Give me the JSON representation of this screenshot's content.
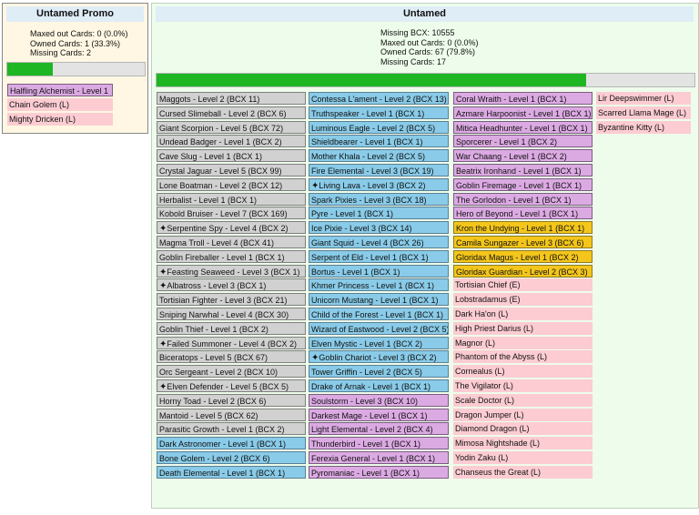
{
  "colors": {
    "common": "#d1d1d1",
    "rare": "#89cbe8",
    "epic": "#dcaae3",
    "legendary": "#f4c61b",
    "missing": "#fcccd2",
    "progress": "#1fb623"
  },
  "promo": {
    "title": "Untamed Promo",
    "stats": [
      "Maxed out Cards: 0 (0.0%)",
      "Owned Cards: 1 (33.3%)",
      "Missing Cards: 2"
    ],
    "progress": 0.333,
    "cards": [
      {
        "label": "Halfling Alchemist - Level 1",
        "color": "purple"
      },
      {
        "label": "Chain Golem (L)",
        "color": "pink"
      },
      {
        "label": "Mighty Dricken (L)",
        "color": "pink"
      }
    ]
  },
  "untamed": {
    "title": "Untamed",
    "stats": [
      "Missing BCX: 10555",
      "Maxed out Cards: 0 (0.0%)",
      "Owned Cards: 67 (79.8%)",
      "Missing Cards: 17"
    ],
    "progress": 0.798,
    "columns": [
      [
        {
          "label": "Maggots - Level 2 (BCX 11)",
          "color": "gray"
        },
        {
          "label": "Cursed Slimeball - Level 2 (BCX 6)",
          "color": "gray"
        },
        {
          "label": "Giant Scorpion - Level 5 (BCX 72)",
          "color": "gray"
        },
        {
          "label": "Undead Badger - Level 1 (BCX 2)",
          "color": "gray"
        },
        {
          "label": "Cave Slug - Level 1 (BCX 1)",
          "color": "gray"
        },
        {
          "label": "Crystal Jaguar - Level 5 (BCX 99)",
          "color": "gray"
        },
        {
          "label": "Lone Boatman - Level 2 (BCX 12)",
          "color": "gray"
        },
        {
          "label": "Herbalist - Level 1 (BCX 1)",
          "color": "gray"
        },
        {
          "label": "Kobold Bruiser - Level 7 (BCX 169)",
          "color": "gray"
        },
        {
          "label": "Serpentine Spy - Level 4 (BCX 2)",
          "color": "gray",
          "star": true
        },
        {
          "label": "Magma Troll - Level 4 (BCX 41)",
          "color": "gray"
        },
        {
          "label": "Goblin Fireballer - Level 1 (BCX 1)",
          "color": "gray"
        },
        {
          "label": "Feasting Seaweed - Level 3 (BCX 1)",
          "color": "gray",
          "star": true
        },
        {
          "label": "Albatross - Level 3 (BCX 1)",
          "color": "gray",
          "star": true
        },
        {
          "label": "Tortisian Fighter - Level 3 (BCX 21)",
          "color": "gray"
        },
        {
          "label": "Sniping Narwhal - Level 4 (BCX 30)",
          "color": "gray"
        },
        {
          "label": "Goblin Thief - Level 1 (BCX 2)",
          "color": "gray"
        },
        {
          "label": "Failed Summoner - Level 4 (BCX 2)",
          "color": "gray",
          "star": true
        },
        {
          "label": "Biceratops - Level 5 (BCX 67)",
          "color": "gray"
        },
        {
          "label": "Orc Sergeant - Level 2 (BCX 10)",
          "color": "gray"
        },
        {
          "label": "Elven Defender - Level 5 (BCX 5)",
          "color": "gray",
          "star": true
        },
        {
          "label": "Horny Toad - Level 2 (BCX 6)",
          "color": "gray"
        },
        {
          "label": "Mantoid - Level 5 (BCX 62)",
          "color": "gray"
        },
        {
          "label": "Parasitic Growth - Level 1 (BCX 2)",
          "color": "gray"
        },
        {
          "label": "Dark Astronomer - Level 1 (BCX 1)",
          "color": "blue"
        },
        {
          "label": "Bone Golem - Level 2 (BCX 6)",
          "color": "blue"
        },
        {
          "label": "Death Elemental - Level 1 (BCX 1)",
          "color": "blue"
        }
      ],
      [
        {
          "label": "Contessa L'ament - Level 2 (BCX 13)",
          "color": "blue"
        },
        {
          "label": "Truthspeaker - Level 1 (BCX 1)",
          "color": "blue"
        },
        {
          "label": "Luminous Eagle - Level 2 (BCX 5)",
          "color": "blue"
        },
        {
          "label": "Shieldbearer - Level 1 (BCX 1)",
          "color": "blue"
        },
        {
          "label": "Mother Khala - Level 2 (BCX 5)",
          "color": "blue"
        },
        {
          "label": "Fire Elemental - Level 3 (BCX 19)",
          "color": "blue"
        },
        {
          "label": "Living Lava - Level 3 (BCX 2)",
          "color": "blue",
          "star": true
        },
        {
          "label": "Spark Pixies - Level 3 (BCX 18)",
          "color": "blue"
        },
        {
          "label": "Pyre - Level 1 (BCX 1)",
          "color": "blue"
        },
        {
          "label": "Ice Pixie - Level 3 (BCX 14)",
          "color": "blue"
        },
        {
          "label": "Giant Squid - Level 4 (BCX 26)",
          "color": "blue"
        },
        {
          "label": "Serpent of Eld - Level 1 (BCX 1)",
          "color": "blue"
        },
        {
          "label": "Bortus - Level 1 (BCX 1)",
          "color": "blue"
        },
        {
          "label": "Khmer Princess - Level 1 (BCX 1)",
          "color": "blue"
        },
        {
          "label": "Unicorn Mustang - Level 1 (BCX 1)",
          "color": "blue"
        },
        {
          "label": "Child of the Forest - Level 1 (BCX 1)",
          "color": "blue"
        },
        {
          "label": "Wizard of Eastwood - Level 2 (BCX 5)",
          "color": "blue"
        },
        {
          "label": "Elven Mystic - Level 1 (BCX 2)",
          "color": "blue"
        },
        {
          "label": "Goblin Chariot - Level 3 (BCX 2)",
          "color": "blue",
          "star": true
        },
        {
          "label": "Tower Griffin - Level 2 (BCX 5)",
          "color": "blue"
        },
        {
          "label": "Drake of Arnak - Level 1 (BCX 1)",
          "color": "blue"
        },
        {
          "label": "Soulstorm - Level 3 (BCX 10)",
          "color": "purple"
        },
        {
          "label": "Darkest Mage - Level 1 (BCX 1)",
          "color": "purple"
        },
        {
          "label": "Light Elemental - Level 2 (BCX 4)",
          "color": "purple"
        },
        {
          "label": "Thunderbird - Level 1 (BCX 1)",
          "color": "purple"
        },
        {
          "label": "Ferexia General - Level 1 (BCX 1)",
          "color": "purple"
        },
        {
          "label": "Pyromaniac - Level 1 (BCX 1)",
          "color": "purple"
        }
      ],
      [
        {
          "label": "Coral Wraith - Level 1 (BCX 1)",
          "color": "purple"
        },
        {
          "label": "Azmare Harpoonist - Level 1 (BCX 1)",
          "color": "purple"
        },
        {
          "label": "Mitica Headhunter - Level 1 (BCX 1)",
          "color": "purple"
        },
        {
          "label": "Sporcerer - Level 1 (BCX 2)",
          "color": "purple"
        },
        {
          "label": "War Chaang - Level 1 (BCX 2)",
          "color": "purple"
        },
        {
          "label": "Beatrix Ironhand - Level 1 (BCX 1)",
          "color": "purple"
        },
        {
          "label": "Goblin Firemage - Level 1 (BCX 1)",
          "color": "purple"
        },
        {
          "label": "The Gorlodon - Level 1 (BCX 1)",
          "color": "purple"
        },
        {
          "label": "Hero of Beyond - Level 1 (BCX 1)",
          "color": "purple"
        },
        {
          "label": "Kron the Undying - Level 1 (BCX 1)",
          "color": "gold"
        },
        {
          "label": "Camila Sungazer - Level 3 (BCX 6)",
          "color": "gold"
        },
        {
          "label": "Gloridax Magus - Level 1 (BCX 2)",
          "color": "gold"
        },
        {
          "label": "Gloridax Guardian - Level 2 (BCX 3)",
          "color": "gold"
        },
        {
          "label": "Tortisian Chief (E)",
          "color": "pink"
        },
        {
          "label": "Lobstradamus (E)",
          "color": "pink"
        },
        {
          "label": "Dark Ha'on (L)",
          "color": "pink"
        },
        {
          "label": "High Priest Darius (L)",
          "color": "pink"
        },
        {
          "label": "Magnor (L)",
          "color": "pink"
        },
        {
          "label": "Phantom of the Abyss (L)",
          "color": "pink"
        },
        {
          "label": "Cornealus (L)",
          "color": "pink"
        },
        {
          "label": "The Vigilator (L)",
          "color": "pink"
        },
        {
          "label": "Scale Doctor (L)",
          "color": "pink"
        },
        {
          "label": "Dragon Jumper (L)",
          "color": "pink"
        },
        {
          "label": "Diamond Dragon (L)",
          "color": "pink"
        },
        {
          "label": "Mimosa Nightshade (L)",
          "color": "pink"
        },
        {
          "label": "Yodin Zaku (L)",
          "color": "pink"
        },
        {
          "label": "Chanseus the Great (L)",
          "color": "pink"
        }
      ],
      [
        {
          "label": "Lir Deepswimmer (L)",
          "color": "pink"
        },
        {
          "label": "Scarred Llama Mage (L)",
          "color": "pink"
        },
        {
          "label": "Byzantine Kitty (L)",
          "color": "pink"
        }
      ]
    ]
  }
}
